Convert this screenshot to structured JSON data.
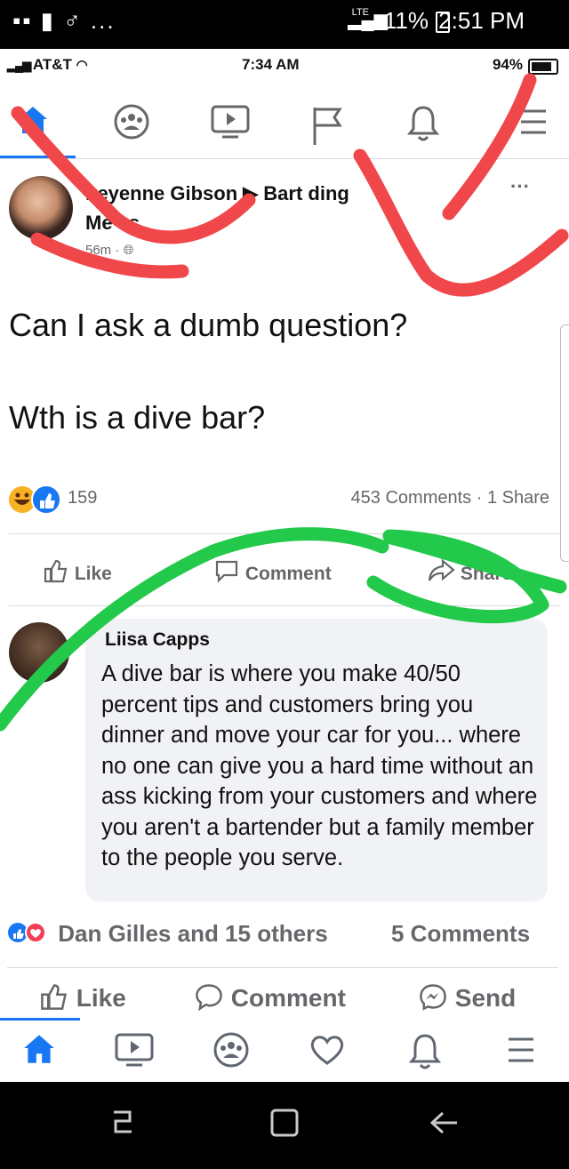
{
  "outer_status": {
    "left_icons": "▪▪ ▮ ♂ ...",
    "lte_badge": "LTE",
    "signal": "▂▄▆",
    "battery": "11%",
    "time": "2:51 PM"
  },
  "inner_status": {
    "carrier": "AT&T",
    "time": "7:34 AM",
    "battery": "94%"
  },
  "top_nav": [
    {
      "icon": "home-icon"
    },
    {
      "icon": "groups-icon"
    },
    {
      "icon": "watch-icon"
    },
    {
      "icon": "pages-flag-icon"
    },
    {
      "icon": "bell-icon"
    },
    {
      "icon": "menu-icon"
    }
  ],
  "post": {
    "author_line1": "heyenne Gibson ▶ Bart ding",
    "author_line2": "Me es",
    "time": "56m ·",
    "more": "···",
    "text_line1": "Can I ask a dumb question?",
    "text_line2": "Wth is a dive bar?",
    "reaction_count": "159",
    "stats": "453 Comments · 1 Share",
    "actions": {
      "like": "Like",
      "comment": "Comment",
      "share": "Share"
    }
  },
  "comment": {
    "author": "Liisa Capps",
    "text": "A dive bar is where you make 40/50 percent tips and customers bring you dinner and move your car for you... where no one can give you a hard time without an ass kicking from your customers and where you aren't a bartender but a family member to the people you serve."
  },
  "bottom_bar": {
    "reactors": "Dan Gilles and 15 others",
    "comments": "5 Comments",
    "like": "Like",
    "comment": "Comment",
    "send": "Send"
  },
  "colors": {
    "facebook_blue": "#1877f2",
    "red_marker": "#f0474a",
    "green_marker": "#22c94a"
  }
}
